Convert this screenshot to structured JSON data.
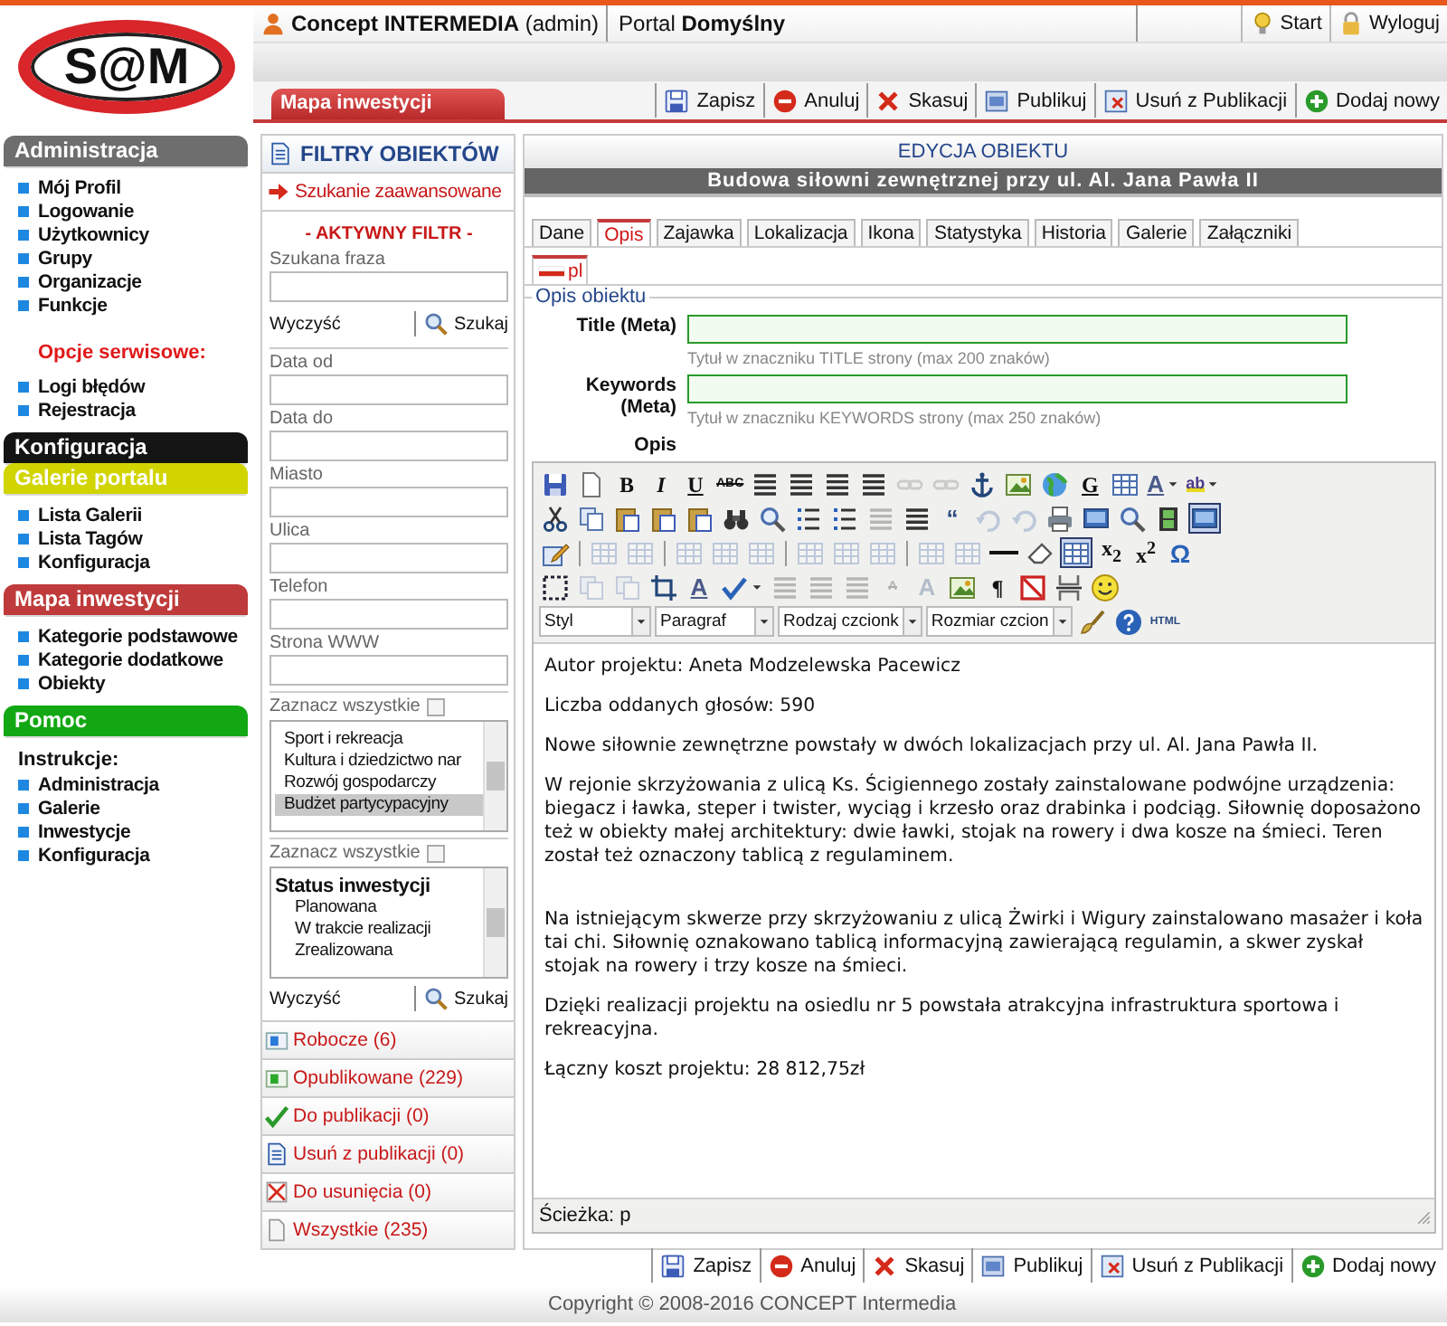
{
  "header": {
    "logo": "S@M",
    "user": "Concept INTERMEDIA",
    "role": "(admin)",
    "portal_prefix": "Portal",
    "portal": "Domyślny",
    "links": [
      {
        "kind": "start",
        "label": "Start"
      },
      {
        "kind": "logout",
        "label": "Wyloguj"
      }
    ]
  },
  "module_tab": "Mapa inwestycji",
  "actions": [
    {
      "kind": "save",
      "label": "Zapisz"
    },
    {
      "kind": "cancel",
      "label": "Anuluj"
    },
    {
      "kind": "delete",
      "label": "Skasuj"
    },
    {
      "kind": "publish",
      "label": "Publikuj"
    },
    {
      "kind": "unpublish",
      "label": "Usuń z Publikacji"
    },
    {
      "kind": "add",
      "label": "Dodaj nowy"
    }
  ],
  "sidebar": [
    {
      "title": "Administracja",
      "color": "#6e6e6e",
      "items": [
        {
          "kind": "link",
          "label": "Mój Profil"
        },
        {
          "kind": "link",
          "label": "Logowanie"
        },
        {
          "kind": "link",
          "label": "Użytkownicy"
        },
        {
          "kind": "link",
          "label": "Grupy"
        },
        {
          "kind": "link",
          "label": "Organizacje"
        },
        {
          "kind": "link",
          "label": "Funkcje"
        },
        {
          "kind": "note",
          "label": "Opcje serwisowe:"
        },
        {
          "kind": "link",
          "label": "Logi błędów"
        },
        {
          "kind": "link",
          "label": "Rejestracja"
        }
      ]
    },
    {
      "title": "Konfiguracja",
      "color": "#141414"
    },
    {
      "title": "Galerie portalu",
      "color": "#d2d400",
      "items": [
        {
          "kind": "link",
          "label": "Lista Galerii"
        },
        {
          "kind": "link",
          "label": "Lista Tagów"
        },
        {
          "kind": "link",
          "label": "Konfiguracja"
        }
      ]
    },
    {
      "title": "Mapa inwestycji",
      "color": "#bf3a3a",
      "items": [
        {
          "kind": "link",
          "label": "Kategorie podstawowe"
        },
        {
          "kind": "link",
          "label": "Kategorie dodatkowe"
        },
        {
          "kind": "link",
          "label": "Obiekty"
        }
      ]
    },
    {
      "title": "Pomoc",
      "color": "#13a813",
      "items": [
        {
          "kind": "label",
          "label": "Instrukcje:"
        },
        {
          "kind": "link",
          "label": "Administracja"
        },
        {
          "kind": "link",
          "label": "Galerie"
        },
        {
          "kind": "link",
          "label": "Inwestycje"
        },
        {
          "kind": "link",
          "label": "Konfiguracja"
        }
      ]
    }
  ],
  "filters": {
    "title": "FILTRY OBIEKTÓW",
    "advanced": "Szukanie zaawansowane",
    "active": "- AKTYWNY FILTR -",
    "phrase": "Szukana fraza",
    "clear": "Wyczyść",
    "search": "Szukaj",
    "fields": [
      {
        "label": "Data od"
      },
      {
        "label": "Data do"
      },
      {
        "label": "Miasto"
      },
      {
        "label": "Ulica"
      },
      {
        "label": "Telefon"
      },
      {
        "label": "Strona WWW"
      }
    ],
    "lists": [
      {
        "select_all": "Zaznacz wszystkie",
        "checked": false,
        "items": [
          {
            "label": "Sport i rekreacja",
            "selected": false
          },
          {
            "label": "Kultura i dziedzictwo nar",
            "selected": false
          },
          {
            "label": "Rozwój gospodarczy",
            "selected": false
          },
          {
            "label": "Budżet partycypacyjny",
            "selected": true
          }
        ]
      },
      {
        "select_all": "Zaznacz wszystkie",
        "checked": false,
        "items": [
          {
            "label": "Status inwestycji",
            "selected": false,
            "children": [
              {
                "label": "Planowana",
                "selected": false
              },
              {
                "label": "W trakcie realizacji",
                "selected": false
              },
              {
                "label": "Zrealizowana",
                "selected": false
              }
            ]
          }
        ]
      }
    ],
    "bottom_clear": "Wyczyść",
    "bottom_search": "Szukaj",
    "statuses": [
      {
        "kind": "draft",
        "label": "Robocze (6)"
      },
      {
        "kind": "published",
        "label": "Opublikowane (229)"
      },
      {
        "kind": "to_publish",
        "label": "Do publikacji (0)"
      },
      {
        "kind": "to_unpublish",
        "label": "Usuń z publikacji (0)"
      },
      {
        "kind": "to_delete",
        "label": "Do usunięcia (0)"
      },
      {
        "kind": "all",
        "label": "Wszystkie (235)"
      }
    ]
  },
  "editor": {
    "heading": "EDYCJA OBIEKTU",
    "title": "Budowa siłowni zewnętrznej przy ul. Al. Jana Pawła II",
    "tabs": [
      {
        "label": "Dane",
        "selected": false
      },
      {
        "label": "Opis",
        "selected": true
      },
      {
        "label": "Zajawka",
        "selected": false
      },
      {
        "label": "Lokalizacja",
        "selected": false
      },
      {
        "label": "Ikona",
        "selected": false
      },
      {
        "label": "Statystyka",
        "selected": false
      },
      {
        "label": "Historia",
        "selected": false
      },
      {
        "label": "Galerie",
        "selected": false
      },
      {
        "label": "Załączniki",
        "selected": false
      }
    ],
    "languages": [
      {
        "label": "pl",
        "selected": true
      }
    ],
    "legend": "Opis obiektu",
    "fields": [
      {
        "label": "Title (Meta)",
        "hint": "Tytuł w znaczniku TITLE strony (max 200 znaków)"
      },
      {
        "label": "Keywords (Meta)",
        "hint": "Tytuł w znaczniku KEYWORDS strony (max 250 znaków)"
      }
    ],
    "body_label": "Opis",
    "toolbar": [
      [
        {
          "kind": "floppy",
          "disabled": false,
          "pressed": false
        },
        {
          "kind": "page",
          "disabled": false,
          "pressed": false
        },
        {
          "kind": "bold",
          "label": "B",
          "disabled": false,
          "pressed": false
        },
        {
          "kind": "italic",
          "label": "I",
          "disabled": false,
          "pressed": false
        },
        {
          "kind": "underline",
          "label": "U",
          "disabled": false,
          "pressed": false
        },
        {
          "kind": "strike",
          "label": "ABC",
          "disabled": false,
          "pressed": false
        },
        {
          "kind": "lines",
          "disabled": false,
          "pressed": false
        },
        {
          "kind": "lines",
          "disabled": false,
          "pressed": false
        },
        {
          "kind": "lines",
          "disabled": false,
          "pressed": false
        },
        {
          "kind": "lines",
          "disabled": false,
          "pressed": false
        },
        {
          "kind": "chain",
          "disabled": true,
          "pressed": false
        },
        {
          "kind": "chain",
          "disabled": true,
          "pressed": false
        },
        {
          "kind": "anchor",
          "disabled": false,
          "pressed": false
        },
        {
          "kind": "picture",
          "disabled": false,
          "pressed": false
        },
        {
          "kind": "globe",
          "disabled": false,
          "pressed": false
        },
        {
          "kind": "underline",
          "label": "G",
          "disabled": false,
          "pressed": false
        },
        {
          "kind": "grid",
          "disabled": false,
          "pressed": false
        },
        {
          "kind": "color",
          "label": "A",
          "dropdown": true,
          "disabled": false,
          "pressed": false
        },
        {
          "kind": "highlight",
          "label": "ab",
          "dropdown": true,
          "disabled": false,
          "pressed": false
        }
      ],
      [
        {
          "kind": "scissors",
          "disabled": false,
          "pressed": false
        },
        {
          "kind": "pages",
          "disabled": false,
          "pressed": false
        },
        {
          "kind": "clipboard",
          "disabled": false,
          "pressed": false
        },
        {
          "kind": "clipboard",
          "disabled": false,
          "pressed": false
        },
        {
          "kind": "clipboard",
          "disabled": false,
          "pressed": false
        },
        {
          "kind": "binoculars",
          "disabled": false,
          "pressed": false
        },
        {
          "kind": "magnifier",
          "disabled": false,
          "pressed": false
        },
        {
          "kind": "list",
          "disabled": false,
          "pressed": false
        },
        {
          "kind": "list",
          "disabled": false,
          "pressed": false
        },
        {
          "kind": "lines",
          "disabled": true,
          "pressed": false
        },
        {
          "kind": "lines",
          "disabled": false,
          "pressed": false
        },
        {
          "kind": "text",
          "label": "“",
          "disabled": false,
          "pressed": false
        },
        {
          "kind": "arrow",
          "disabled": true,
          "pressed": false
        },
        {
          "kind": "arrow",
          "disabled": true,
          "pressed": false
        },
        {
          "kind": "printer",
          "disabled": false,
          "pressed": false
        },
        {
          "kind": "monitor",
          "disabled": false,
          "pressed": false
        },
        {
          "kind": "magnifier",
          "disabled": false,
          "pressed": false
        },
        {
          "kind": "film",
          "disabled": false,
          "pressed": false
        },
        {
          "kind": "monitor",
          "disabled": false,
          "pressed": true
        }
      ],
      [
        {
          "kind": "pencil",
          "disabled": false,
          "pressed": false
        },
        {
          "kind": "separator"
        },
        {
          "kind": "grid",
          "disabled": true,
          "pressed": false
        },
        {
          "kind": "grid",
          "disabled": true,
          "pressed": false
        },
        {
          "kind": "separator"
        },
        {
          "kind": "grid",
          "disabled": true,
          "pressed": false
        },
        {
          "kind": "grid",
          "disabled": true,
          "pressed": false
        },
        {
          "kind": "grid",
          "disabled": true,
          "pressed": false
        },
        {
          "kind": "separator"
        },
        {
          "kind": "grid",
          "disabled": true,
          "pressed": false
        },
        {
          "kind": "grid",
          "disabled": true,
          "pressed": false
        },
        {
          "kind": "grid",
          "disabled": true,
          "pressed": false
        },
        {
          "kind": "separator"
        },
        {
          "kind": "grid",
          "disabled": true,
          "pressed": false
        },
        {
          "kind": "grid",
          "disabled": true,
          "pressed": false
        },
        {
          "kind": "dash",
          "disabled": false,
          "pressed": false
        },
        {
          "kind": "eraser",
          "disabled": false,
          "pressed": false
        },
        {
          "kind": "grid",
          "disabled": false,
          "pressed": true
        },
        {
          "kind": "bold",
          "label": "x$_{2}$",
          "disabled": false,
          "pressed": false
        },
        {
          "kind": "bold",
          "label": "x$^{2}$",
          "disabled": false,
          "pressed": false
        },
        {
          "kind": "symbol",
          "label": "Ω",
          "disabled": false,
          "pressed": false
        }
      ],
      [
        {
          "kind": "dotted",
          "disabled": false,
          "pressed": false
        },
        {
          "kind": "pages",
          "disabled": true,
          "pressed": false
        },
        {
          "kind": "pages",
          "disabled": true,
          "pressed": false
        },
        {
          "kind": "crop",
          "disabled": false,
          "pressed": false
        },
        {
          "kind": "color",
          "label": "A",
          "disabled": false,
          "pressed": false
        },
        {
          "kind": "check",
          "dropdown": true,
          "disabled": false,
          "pressed": false
        },
        {
          "kind": "lines",
          "disabled": true,
          "pressed": false
        },
        {
          "kind": "lines",
          "disabled": true,
          "pressed": false
        },
        {
          "kind": "lines",
          "disabled": true,
          "pressed": false
        },
        {
          "kind": "strike",
          "label": "A",
          "disabled": true,
          "pressed": false
        },
        {
          "kind": "text",
          "label": "A",
          "disabled": true,
          "pressed": false
        },
        {
          "kind": "picture",
          "disabled": false,
          "pressed": false
        },
        {
          "kind": "bold",
          "label": "¶",
          "disabled": false,
          "pressed": false
        },
        {
          "kind": "crossed",
          "disabled": false,
          "pressed": false
        },
        {
          "kind": "pagebreak",
          "disabled": false,
          "pressed": false
        },
        {
          "kind": "smiley",
          "disabled": false,
          "pressed": false
        }
      ],
      [
        {
          "kind": "select",
          "label": "Styl"
        },
        {
          "kind": "select",
          "label": "Paragraf"
        },
        {
          "kind": "select",
          "label": "Rodzaj czcionk"
        },
        {
          "kind": "select",
          "label": "Rozmiar czcion"
        },
        {
          "kind": "brush",
          "disabled": false,
          "pressed": false
        },
        {
          "kind": "help",
          "disabled": false,
          "pressed": false
        },
        {
          "kind": "tiny",
          "label": "HTML",
          "disabled": false,
          "pressed": false
        }
      ]
    ],
    "content": [
      "Autor projektu: Aneta Modzelewska Pacewicz",
      "Liczba oddanych głosów: 590",
      "Nowe siłownie zewnętrzne powstały w dwóch lokalizacjach przy ul. Al. Jana Pawła II.",
      "W rejonie skrzyżowania z ulicą Ks. Ścigiennego zostały zainstalowane podwójne urządzenia: biegacz i ławka, steper i twister, wyciąg i krzesło oraz drabinka i podciąg. Siłownię doposażono też w obiekty małej architektury: dwie ławki, stojak na rowery i dwa kosze na śmieci. Teren został też oznaczony tablicą z regulaminem.",
      "Na istniejącym skwerze przy skrzyżowaniu z ulicą Żwirki i Wigury zainstalowano masażer i koła tai chi. Siłownię oznakowano tablicą informacyjną zawierającą regulamin, a skwer zyskał stojak na rowery i trzy kosze na śmieci.",
      "Dzięki realizacji projektu na osiedlu nr 5 powstała atrakcyjna infrastruktura sportowa i rekreacyjna.",
      "Łączny koszt projektu: 28 812,75zł"
    ],
    "path": "Ścieżka: p"
  },
  "bottom_actions": [
    {
      "kind": "save",
      "label": "Zapisz"
    },
    {
      "kind": "cancel",
      "label": "Anuluj"
    },
    {
      "kind": "delete",
      "label": "Skasuj"
    },
    {
      "kind": "publish",
      "label": "Publikuj"
    },
    {
      "kind": "unpublish",
      "label": "Usuń z Publikacji"
    },
    {
      "kind": "add",
      "label": "Dodaj nowy"
    }
  ],
  "footer": "Copyright © 2008-2016 CONCEPT Intermedia"
}
